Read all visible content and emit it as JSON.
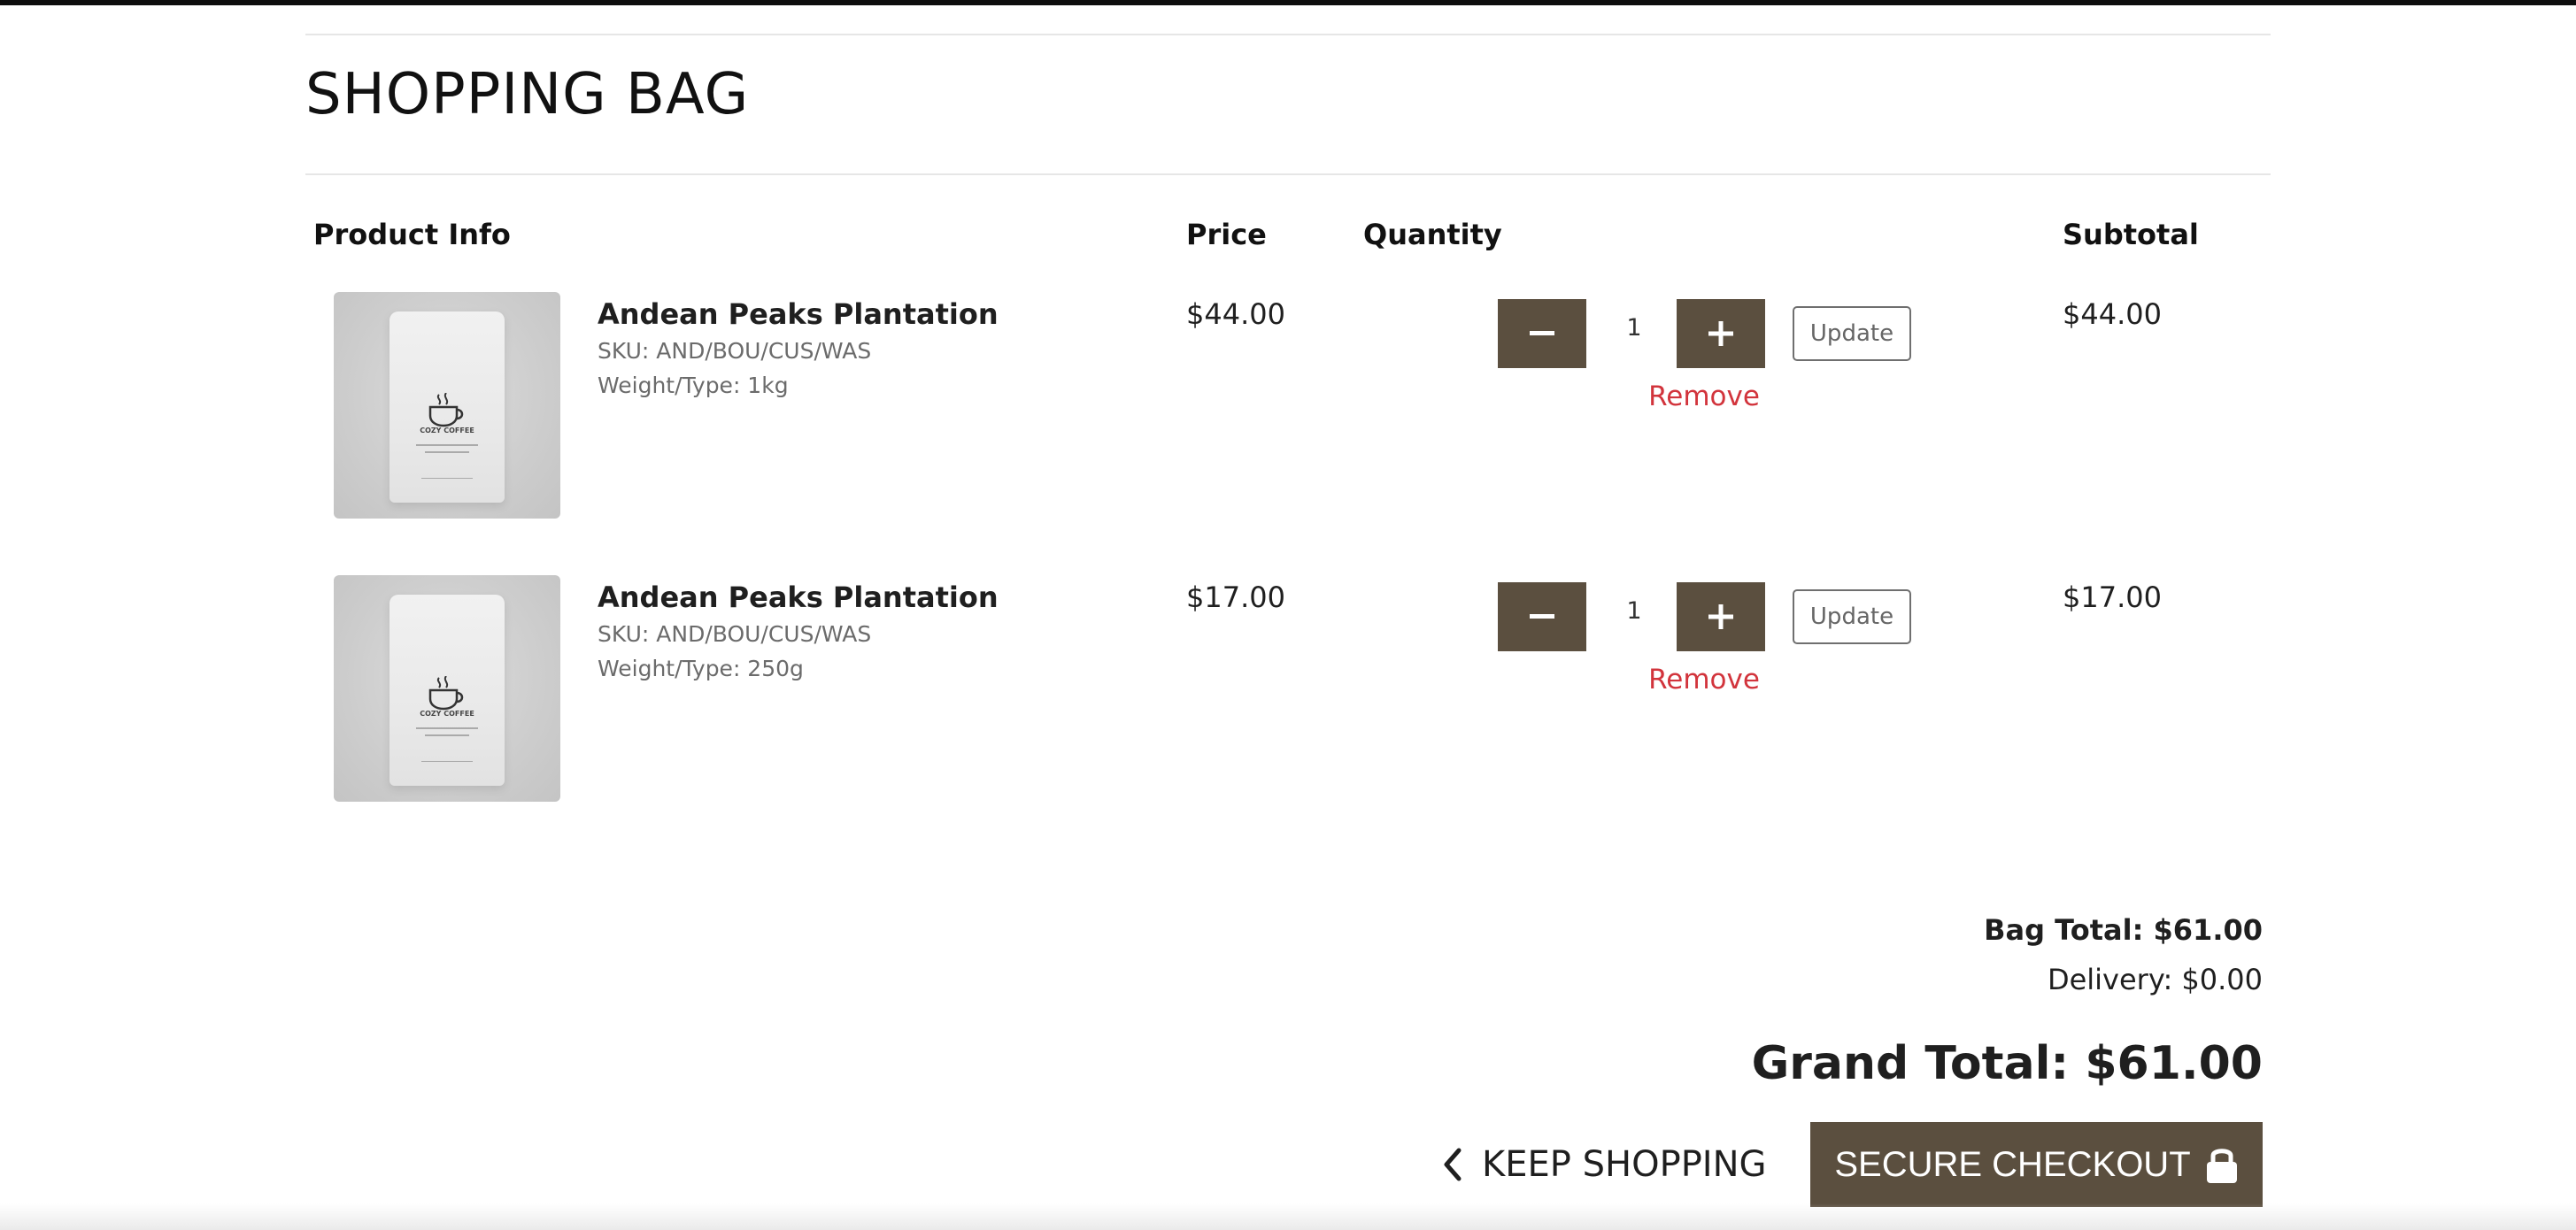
{
  "page": {
    "title": "SHOPPING BAG"
  },
  "table": {
    "headers": {
      "product_info": "Product Info",
      "price": "Price",
      "quantity": "Quantity",
      "subtotal": "Subtotal"
    }
  },
  "items": [
    {
      "name": "Andean Peaks Plantation",
      "sku": "SKU: AND/BOU/CUS/WAS",
      "weight": "Weight/Type: 1kg",
      "price": "$44.00",
      "quantity": "1",
      "subtotal": "$44.00",
      "update_label": "Update",
      "remove_label": "Remove"
    },
    {
      "name": "Andean Peaks Plantation",
      "sku": "SKU: AND/BOU/CUS/WAS",
      "weight": "Weight/Type: 250g",
      "price": "$17.00",
      "quantity": "1",
      "subtotal": "$17.00",
      "update_label": "Update",
      "remove_label": "Remove"
    }
  ],
  "product_image": {
    "brand_text": "COZY COFFEE",
    "icon": "coffee-bag-icon"
  },
  "summary": {
    "bag_total": "Bag Total: $61.00",
    "delivery": "Delivery: $0.00",
    "grand_total": "Grand Total: $61.00"
  },
  "actions": {
    "keep_shopping": "KEEP SHOPPING",
    "secure_checkout": "SECURE CHECKOUT"
  },
  "icons": {
    "decrease": "minus-icon",
    "increase": "plus-icon",
    "back": "chevron-left-icon",
    "lock": "lock-icon"
  },
  "colors": {
    "button_brown": "#5b4f3f",
    "remove_red": "#d2343c",
    "meta_gray": "#6b6b6b"
  }
}
